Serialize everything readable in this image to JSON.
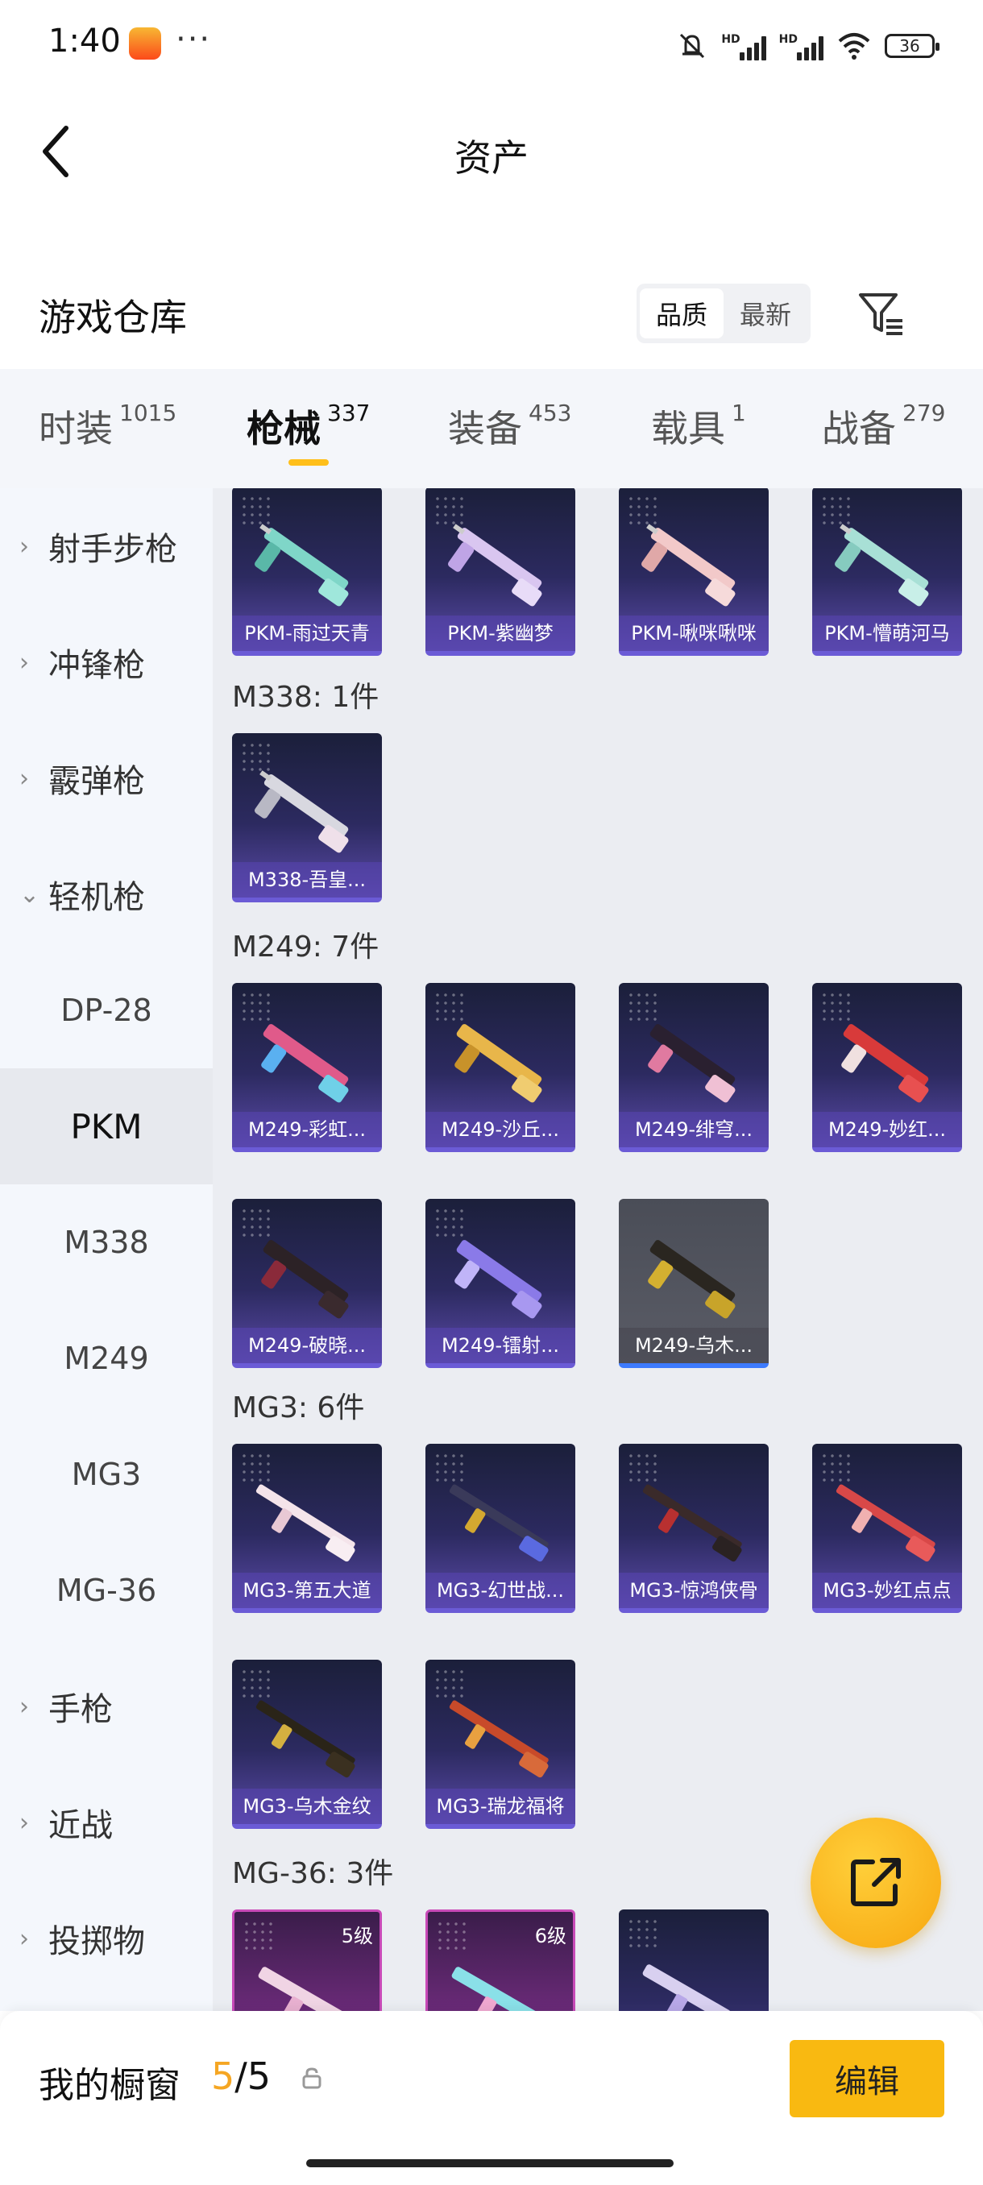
{
  "status_bar": {
    "time": "1:40",
    "dots": "···",
    "battery": "36",
    "hd1": "HD",
    "hd2": "HD"
  },
  "header": {
    "title": "资产"
  },
  "section": {
    "title": "游戏仓库",
    "sort_quality": "品质",
    "sort_newest": "最新"
  },
  "tabs": [
    {
      "label": "时装",
      "count": "1015"
    },
    {
      "label": "枪械",
      "count": "337"
    },
    {
      "label": "装备",
      "count": "453"
    },
    {
      "label": "载具",
      "count": "1"
    },
    {
      "label": "战备",
      "count": "279"
    }
  ],
  "sidebar": {
    "items": [
      {
        "label": "射手步枪"
      },
      {
        "label": "冲锋枪"
      },
      {
        "label": "霰弹枪"
      },
      {
        "label": "轻机枪"
      },
      {
        "label": "DP-28"
      },
      {
        "label": "PKM"
      },
      {
        "label": "M338"
      },
      {
        "label": "M249"
      },
      {
        "label": "MG3"
      },
      {
        "label": "MG-36"
      },
      {
        "label": "手枪"
      },
      {
        "label": "近战"
      },
      {
        "label": "投掷物"
      }
    ]
  },
  "groups": {
    "pkm": {
      "cards": [
        "PKM-雨过天青",
        "PKM-紫幽梦",
        "PKM-啾咪啾咪",
        "PKM-懵萌河马"
      ]
    },
    "m338": {
      "label": "M338: 1件",
      "cards": [
        "M338-吾皇..."
      ]
    },
    "m249": {
      "label": "M249: 7件",
      "cards": [
        "M249-彩虹...",
        "M249-沙丘...",
        "M249-绯穹...",
        "M249-妙红...",
        "M249-破晓...",
        "M249-镭射...",
        "M249-乌木..."
      ]
    },
    "mg3": {
      "label": "MG3: 6件",
      "cards": [
        "MG3-第五大道",
        "MG3-幻世战...",
        "MG3-惊鸿侠骨",
        "MG3-妙红点点",
        "MG3-乌木金纹",
        "MG3-瑞龙福将"
      ]
    },
    "mg36": {
      "label": "MG-36: 3件",
      "levels": [
        "5级",
        "6级"
      ]
    }
  },
  "bottom": {
    "label": "我的橱窗",
    "current": "5",
    "total": "/5",
    "edit": "编辑"
  }
}
